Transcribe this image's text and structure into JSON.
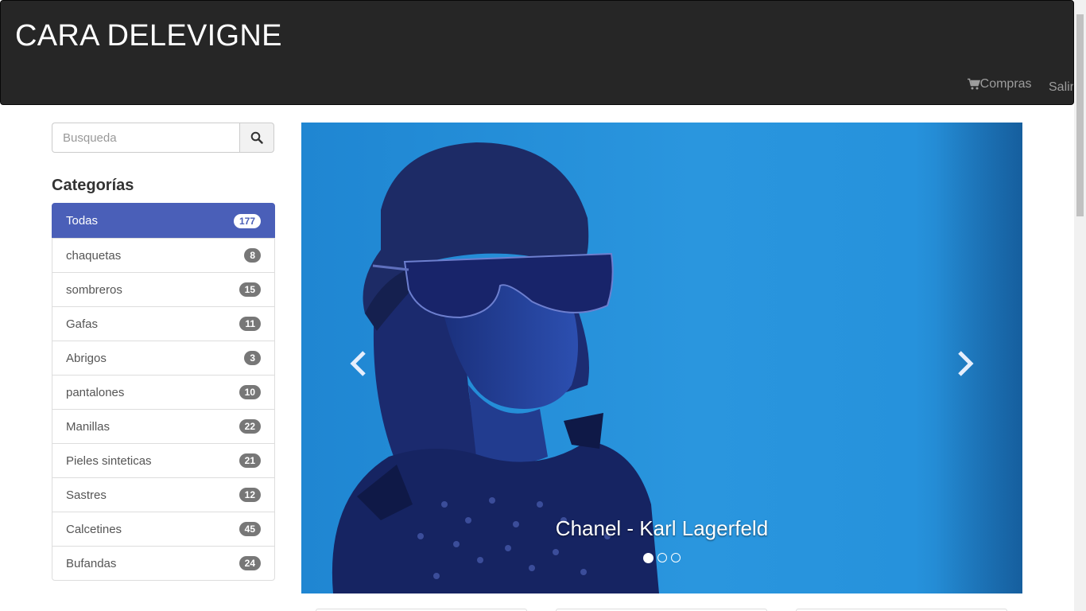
{
  "header": {
    "brand": "CARA DELEVIGNE",
    "nav": {
      "cart_icon": "shopping-cart-icon",
      "compras_label": "Compras",
      "salir_label": "Salir"
    }
  },
  "sidebar": {
    "search": {
      "placeholder": "Busqueda",
      "value": "",
      "button_icon": "search-icon"
    },
    "heading": "Categorías",
    "categories": [
      {
        "label": "Todas",
        "count": "177",
        "active": true
      },
      {
        "label": "chaquetas",
        "count": "8"
      },
      {
        "label": "sombreros",
        "count": "15"
      },
      {
        "label": "Gafas",
        "count": "11"
      },
      {
        "label": "Abrigos",
        "count": "3"
      },
      {
        "label": "pantalones",
        "count": "10"
      },
      {
        "label": "Manillas",
        "count": "22"
      },
      {
        "label": "Pieles sinteticas",
        "count": "21"
      },
      {
        "label": "Sastres",
        "count": "12"
      },
      {
        "label": "Calcetines",
        "count": "45"
      },
      {
        "label": "Bufandas",
        "count": "24"
      }
    ]
  },
  "carousel": {
    "caption": "Chanel - Karl Lagerfeld",
    "prev_icon": "chevron-left-icon",
    "next_icon": "chevron-right-icon",
    "slides_count": 3,
    "active_index": 0
  },
  "colors": {
    "navbar_bg": "#262626",
    "accent_active": "#4a5fb8",
    "carousel_blue": "#2a96de",
    "badge_gray": "#777777"
  }
}
